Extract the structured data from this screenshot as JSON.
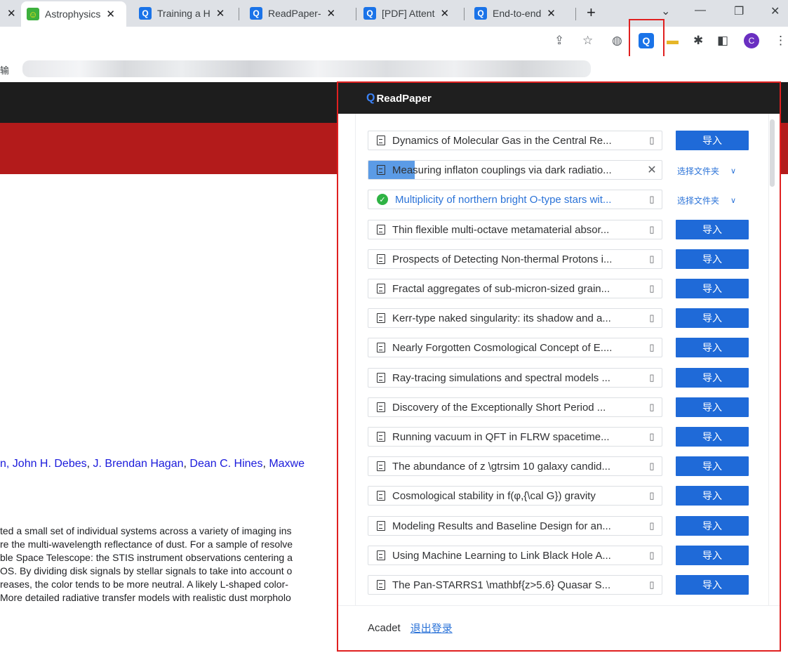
{
  "browser": {
    "tabs": [
      {
        "label": "Astrophysics",
        "close": "✕"
      },
      {
        "label": "Training a H",
        "close": "✕"
      },
      {
        "label": "ReadPaper-",
        "close": "✕"
      },
      {
        "label": "[PDF] Attent",
        "close": "✕"
      },
      {
        "label": "End-to-end",
        "close": "✕"
      }
    ],
    "new_tab": "+",
    "window_controls": {
      "tab_search": "⌄",
      "minimize": "—",
      "restore": "❐",
      "close": "✕"
    },
    "profile_initial": "C",
    "bookmark_label": "输",
    "extension_logo": "Q"
  },
  "page": {
    "authors": [
      "n, John H. Debes",
      "J. Brendan Hagan",
      "Dean C. Hines",
      "Maxwe"
    ],
    "author_separator": ", ",
    "abstract_lines": [
      "ted a small set of individual systems across a variety of imaging ins",
      "re the multi-wavelength reflectance of dust. For a sample of resolve",
      "ble Space Telescope: the STIS instrument observations centering a",
      "OS. By dividing disk signals by stellar signals to take into account o",
      "reases, the color tends to be more neutral. A likely L-shaped color-",
      "More detailed radiative transfer models with realistic dust morpholo"
    ]
  },
  "popup": {
    "brand": "ReadPaper",
    "brand_mark": "Q",
    "import_label": "导入",
    "folder_label": "选择文件夹",
    "items": [
      {
        "title": "Dynamics of Molecular Gas in the Central Re...",
        "status": "pending"
      },
      {
        "title": "Measuring inflaton couplings via dark radiatio...",
        "status": "uploading"
      },
      {
        "title": "Multiplicity of northern bright O-type stars wit...",
        "status": "done"
      },
      {
        "title": "Thin flexible multi-octave metamaterial absor...",
        "status": "pending"
      },
      {
        "title": "Prospects of Detecting Non-thermal Protons i...",
        "status": "pending"
      },
      {
        "title": "Fractal aggregates of sub-micron-sized grain...",
        "status": "pending"
      },
      {
        "title": "Kerr-type naked singularity: its shadow and a...",
        "status": "pending"
      },
      {
        "title": "Nearly Forgotten Cosmological Concept of E....",
        "status": "pending"
      },
      {
        "title": "Ray-tracing simulations and spectral models ...",
        "status": "pending"
      },
      {
        "title": "Discovery of the Exceptionally Short Period ...",
        "status": "pending"
      },
      {
        "title": "Running vacuum in QFT in FLRW spacetime...",
        "status": "pending"
      },
      {
        "title": "The abundance of z \\gtrsim 10 galaxy candid...",
        "status": "pending"
      },
      {
        "title": "Cosmological stability in f(φ,{\\cal G}) gravity",
        "status": "pending"
      },
      {
        "title": "Modeling Results and Baseline Design for an...",
        "status": "pending"
      },
      {
        "title": "Using Machine Learning to Link Black Hole A...",
        "status": "pending"
      },
      {
        "title": "The Pan-STARRS1 \\mathbf{z>5.6} Quasar S...",
        "status": "pending"
      }
    ],
    "footer": {
      "user": "Acadet",
      "logout": "退出登录"
    }
  },
  "colors": {
    "accent_blue": "#1f6ad8",
    "link_blue": "#2b73d8",
    "site_red": "#b31b1b",
    "annotation_red": "#e02020"
  }
}
